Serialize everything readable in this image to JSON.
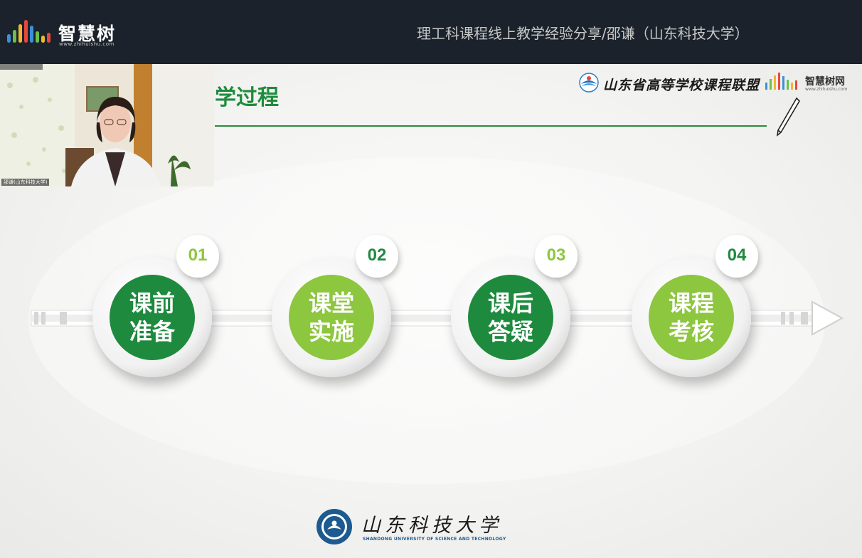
{
  "topbar": {
    "logo_text": "智慧树",
    "logo_url": "www.zhihuishu.com",
    "meeting_title": "理工科课程线上教学经验分享/邵谦（山东科技大学）"
  },
  "slide": {
    "title": "学过程",
    "alliance_text": "山东省高等学校课程联盟",
    "zhs_text": "智慧树网",
    "zhs_url": "www.zhihuishu.com",
    "steps": [
      {
        "number": "01",
        "line1": "课前",
        "line2": "准备",
        "color": "#1e8a3e",
        "number_color": "#8dc63f"
      },
      {
        "number": "02",
        "line1": "课堂",
        "line2": "实施",
        "color": "#8dc63f",
        "number_color": "#1e8a3e"
      },
      {
        "number": "03",
        "line1": "课后",
        "line2": "答疑",
        "color": "#1e8a3e",
        "number_color": "#8dc63f"
      },
      {
        "number": "04",
        "line1": "课程",
        "line2": "考核",
        "color": "#8dc63f",
        "number_color": "#1e8a3e"
      }
    ],
    "university_cn": "山东科技大学",
    "university_en": "SHANDONG UNIVERSITY OF SCIENCE AND TECHNOLOGY"
  },
  "webcam": {
    "name_tag": "邵谦(山东科技大学)"
  },
  "colors": {
    "dark_green": "#1e8a3e",
    "light_green": "#8dc63f",
    "topbar_bg": "#1b222b"
  }
}
